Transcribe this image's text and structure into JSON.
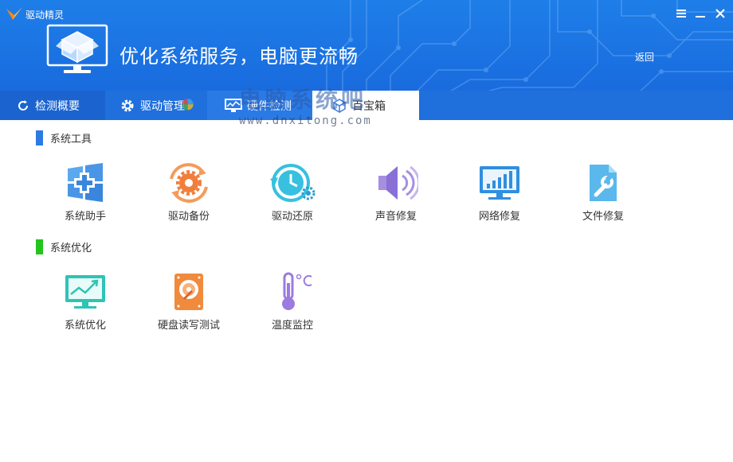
{
  "app": {
    "title": "驱动精灵",
    "slogan": "优化系统服务，电脑更流畅",
    "back": "返回"
  },
  "tabs": [
    {
      "label": "检测概要",
      "icon": "refresh-icon"
    },
    {
      "label": "驱动管理",
      "icon": "gear-icon"
    },
    {
      "label": "硬件检测",
      "icon": "monitor-icon"
    },
    {
      "label": "百宝箱",
      "icon": "toolbox-icon",
      "active": true
    }
  ],
  "watermark": {
    "line1": "电脑系统吧",
    "line2": "www.dnxitong.com"
  },
  "sections": [
    {
      "title": "系统工具",
      "color": "#2c7be5",
      "tools": [
        {
          "label": "系统助手",
          "icon": "windows-plus-icon"
        },
        {
          "label": "驱动备份",
          "icon": "gear-cycle-icon"
        },
        {
          "label": "驱动还原",
          "icon": "clock-restore-icon"
        },
        {
          "label": "声音修复",
          "icon": "speaker-icon"
        },
        {
          "label": "网络修复",
          "icon": "network-monitor-icon"
        },
        {
          "label": "文件修复",
          "icon": "file-wrench-icon"
        }
      ]
    },
    {
      "title": "系统优化",
      "color": "#22c51a",
      "tools": [
        {
          "label": "系统优化",
          "icon": "trend-monitor-icon"
        },
        {
          "label": "硬盘读写测试",
          "icon": "hard-disk-icon"
        },
        {
          "label": "温度监控",
          "icon": "thermometer-icon"
        }
      ]
    }
  ],
  "colors": {
    "header": "#1a6fe0",
    "tab_active_bg": "#ffffff",
    "accent_blue": "#2c7be5",
    "accent_green": "#22c51a"
  }
}
